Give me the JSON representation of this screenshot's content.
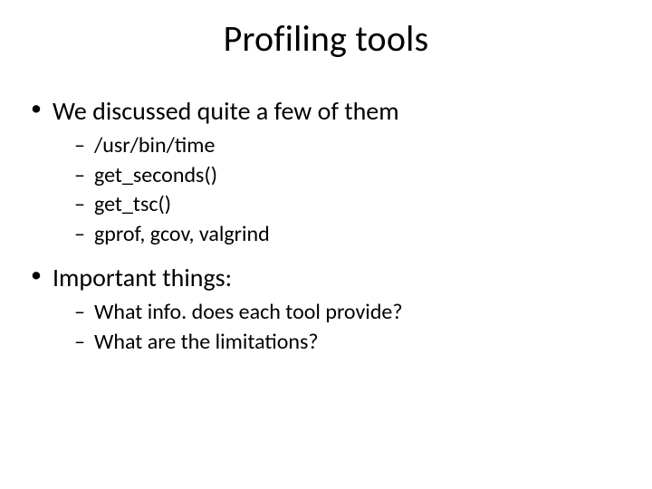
{
  "title": "Profiling tools",
  "bullets": {
    "l1a": "We discussed quite a few of them",
    "l2a": "/usr/bin/time",
    "l2b": "get_seconds()",
    "l2c": "get_tsc()",
    "l2d": "gprof, gcov, valgrind",
    "l1b": "Important things:",
    "l2e": "What info. does each tool provide?",
    "l2f": "What are the limitations?"
  }
}
